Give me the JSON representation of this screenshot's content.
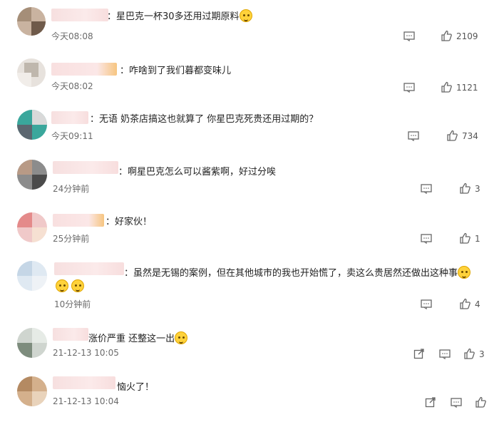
{
  "comments": [
    {
      "text": "：星巴克一杯30多还用过期原料",
      "time": "今天08:08",
      "likes": "2109",
      "emoji": true
    },
    {
      "text": "：咋啥到了我们暮都变味儿",
      "time": "今天08:02",
      "likes": "1121"
    },
    {
      "text": "：无语 奶茶店搞这也就算了 你星巴克死贵还用过期的？",
      "time": "今天09:11",
      "likes": "734"
    },
    {
      "text": "：啊星巴克怎么可以酱紫啊，好过分唉",
      "time": "24分钟前",
      "likes": "3"
    },
    {
      "text": "：好家伙！",
      "time": "25分钟前",
      "likes": "1"
    },
    {
      "text": "：虽然是无锡的案例，但在其他城市的我也开始慌了，卖这么贵居然还做出这种事",
      "time": "10分钟前",
      "likes": "4",
      "emoji": true
    },
    {
      "text": "涨价严重 还整这一出",
      "time": "21-12-13 10:05",
      "likes": "3",
      "emoji": true
    },
    {
      "text": "恼火了！",
      "time": "21-12-13 10:04",
      "likes": ""
    }
  ]
}
